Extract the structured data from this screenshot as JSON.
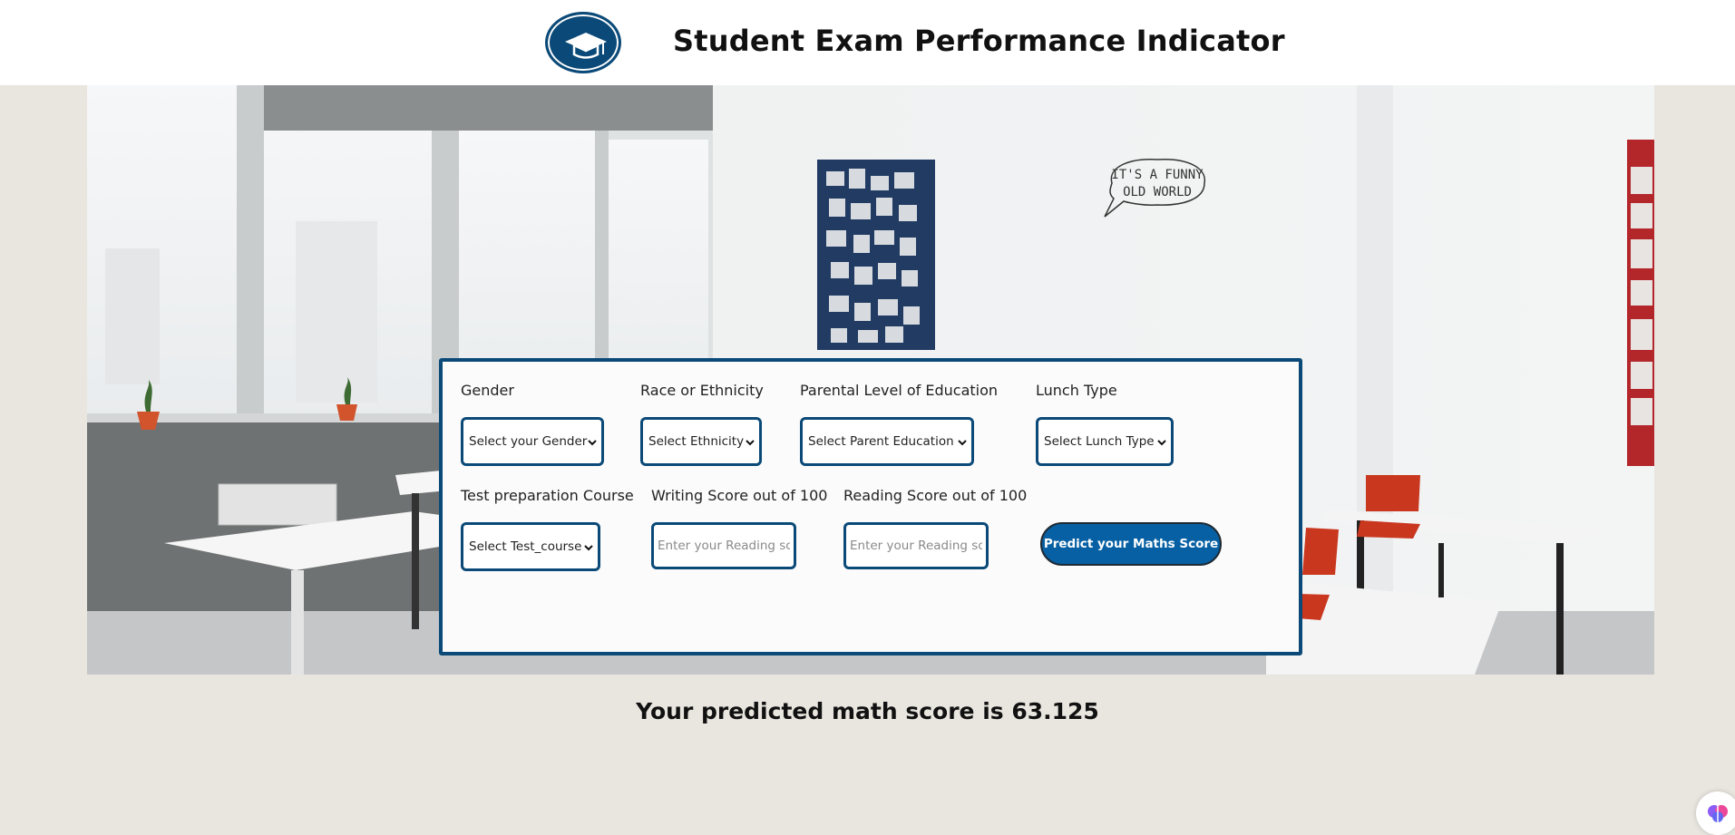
{
  "header": {
    "title": "Student Exam Performance Indicator",
    "logo_icon": "graduation-cap-icon"
  },
  "hero": {
    "speech_bubble_text_line1": "IT'S A FUNNY",
    "speech_bubble_text_line2": "OLD WORLD"
  },
  "form": {
    "gender": {
      "label": "Gender",
      "selected": "Select your Gender"
    },
    "ethnicity": {
      "label": "Race or Ethnicity",
      "selected": "Select Ethnicity"
    },
    "parental_education": {
      "label": "Parental Level of Education",
      "selected": "Select Parent Education"
    },
    "lunch": {
      "label": "Lunch Type",
      "selected": "Select Lunch Type"
    },
    "test_course": {
      "label": "Test preparation Course",
      "selected": "Select Test_course"
    },
    "writing_score": {
      "label": "Writing Score out of 100",
      "placeholder": "Enter your Reading score"
    },
    "reading_score": {
      "label": "Reading Score out of 100",
      "placeholder": "Enter your Reading score"
    },
    "submit_label": "Predict your Maths Score"
  },
  "result": {
    "text": "Your predicted math score is 63.125"
  },
  "colors": {
    "accent": "#0b4a78",
    "button": "#0760a3",
    "page_background": "#e9e6e0"
  }
}
